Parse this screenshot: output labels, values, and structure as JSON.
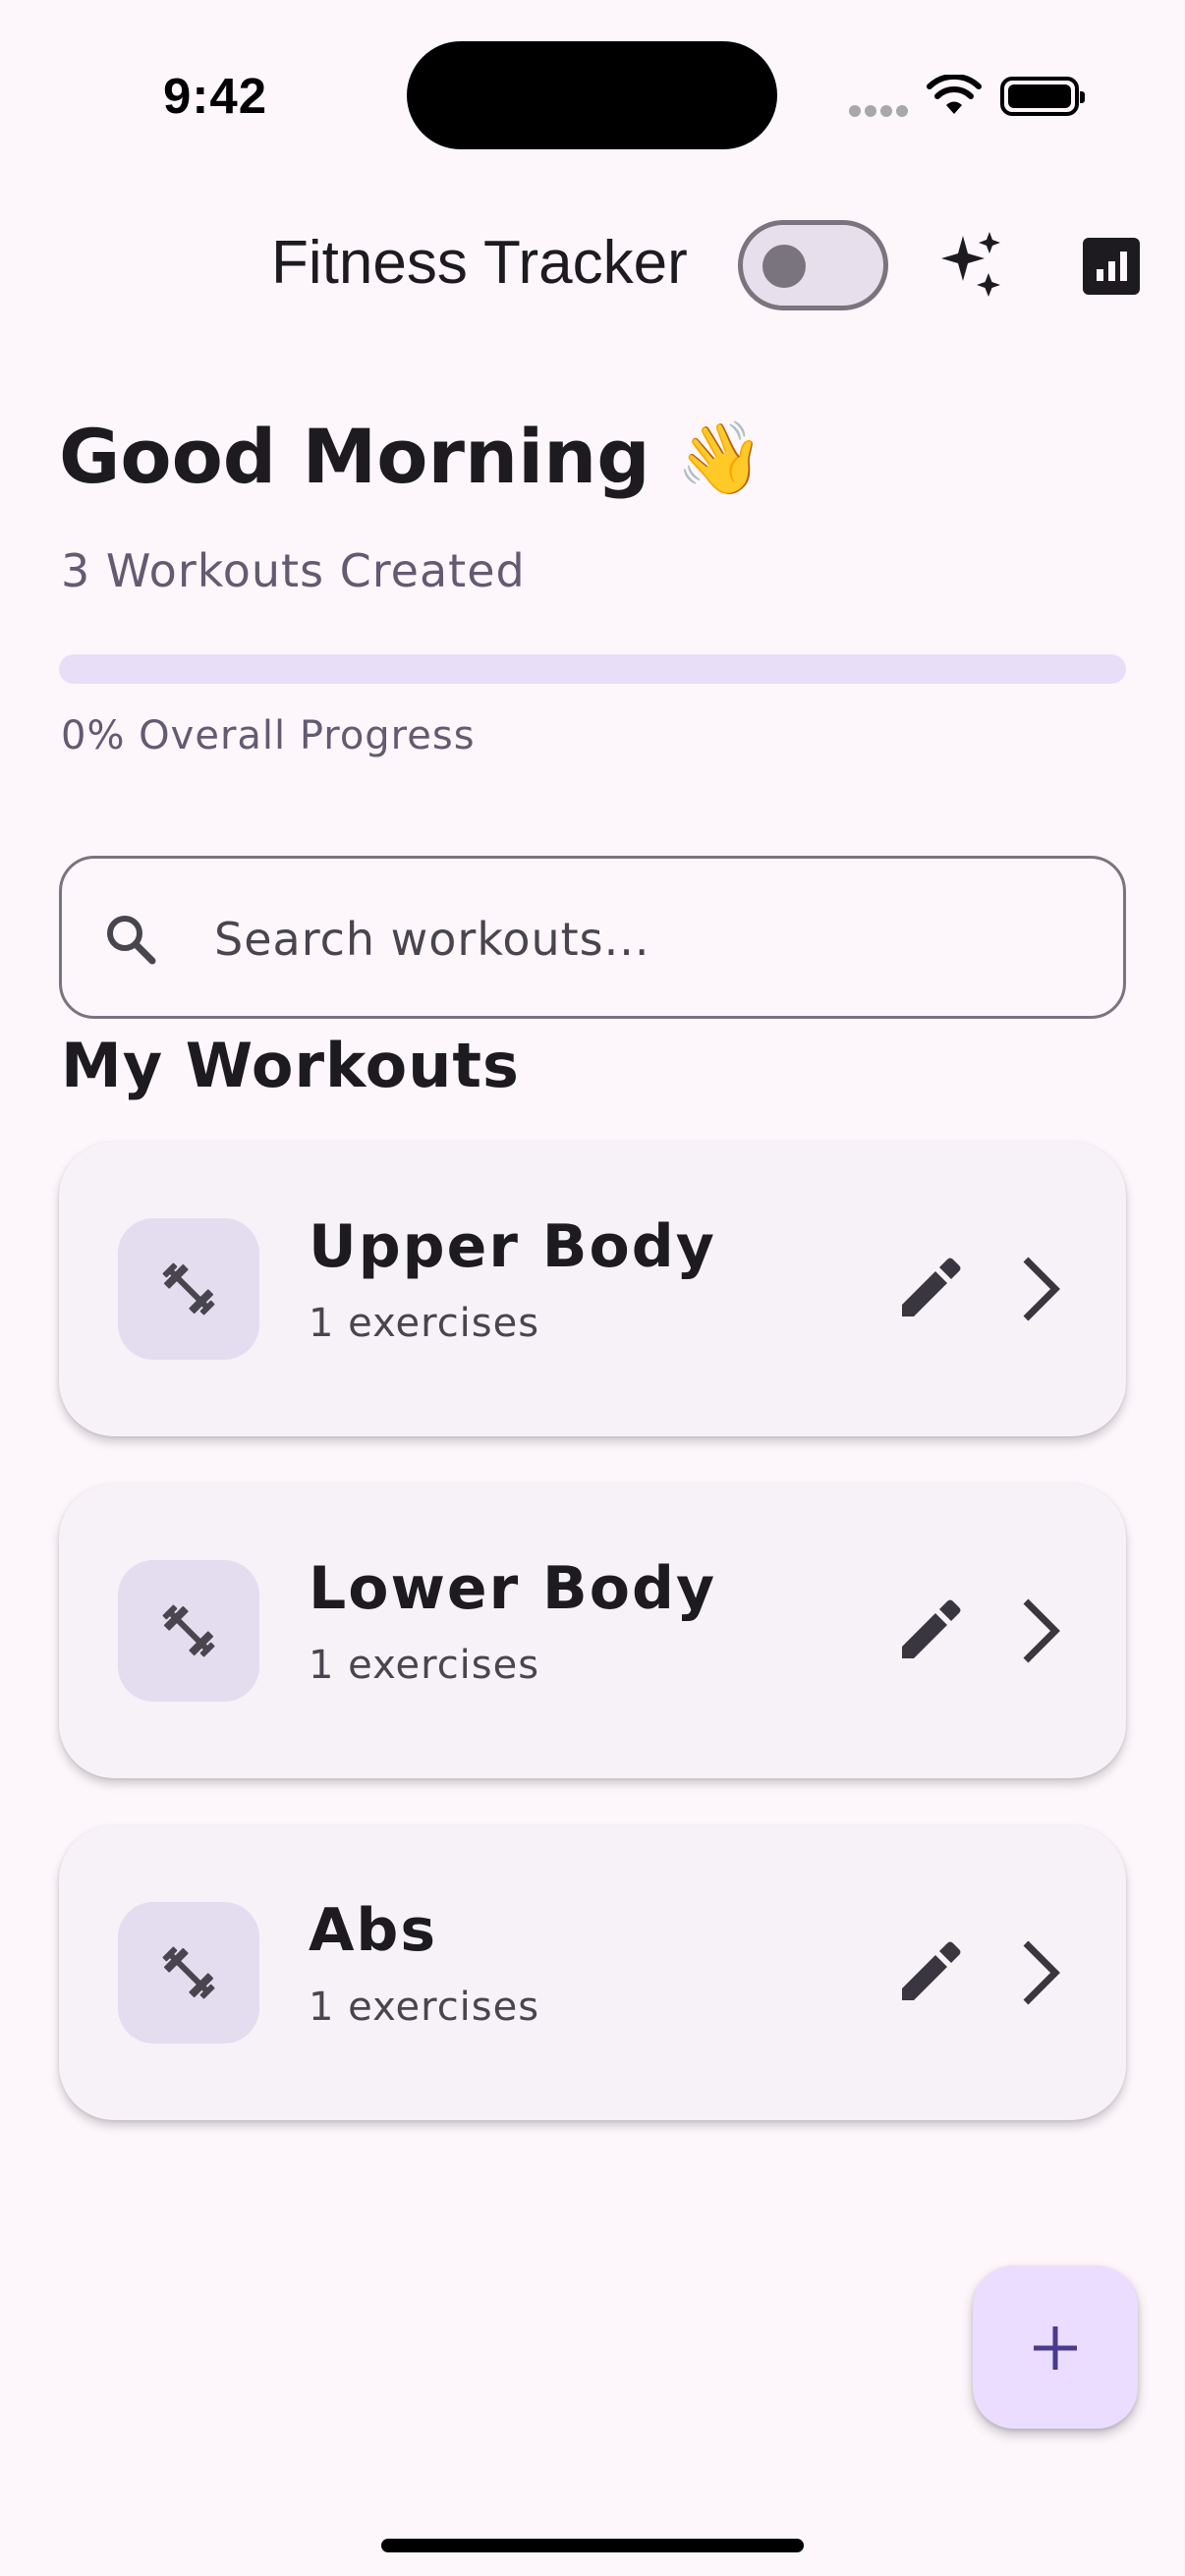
{
  "status_bar": {
    "time": "9:42"
  },
  "app_bar": {
    "title": "Fitness Tracker",
    "toggle_on": false,
    "sparkle_icon": "sparkle-icon",
    "stats_icon": "bar-chart-icon"
  },
  "header": {
    "greeting": "Good Morning",
    "greeting_emoji": "👋",
    "workout_count": "3 Workouts Created",
    "progress_fraction": 0,
    "progress_label": "0% Overall Progress"
  },
  "search": {
    "placeholder": "Search workouts...",
    "value": ""
  },
  "section_title": "My Workouts",
  "workouts": [
    {
      "name": "Upper Body",
      "subtitle": "1 exercises"
    },
    {
      "name": "Lower Body",
      "subtitle": "1 exercises"
    },
    {
      "name": "Abs",
      "subtitle": "1 exercises"
    }
  ],
  "fab": {
    "icon": "plus-icon"
  },
  "colors": {
    "background": "#fdf7fc",
    "card": "#f6f2f7",
    "thumb": "#e4dcef",
    "progress_track": "#e8def8",
    "fab": "#eaddff",
    "accent": "#4a3a8c"
  }
}
